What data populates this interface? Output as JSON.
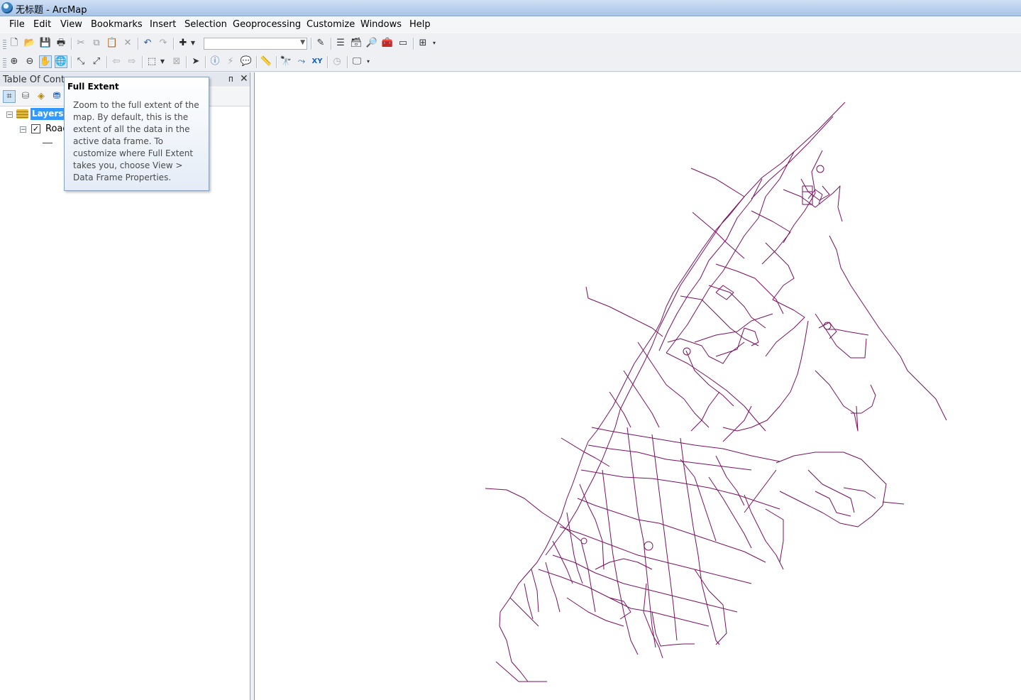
{
  "window": {
    "title": "无标题 - ArcMap"
  },
  "menu": [
    "File",
    "Edit",
    "View",
    "Bookmarks",
    "Insert",
    "Selection",
    "Geoprocessing",
    "Customize",
    "Windows",
    "Help"
  ],
  "standard_toolbar": {
    "tools": [
      "new-document-icon",
      "open-icon",
      "save-icon",
      "print-icon",
      "cut-icon",
      "copy-icon",
      "paste-icon",
      "delete-icon",
      "undo-icon",
      "redo-icon",
      "add-data-icon"
    ],
    "scale_value": "",
    "extra_tools": [
      "editor-icon",
      "table-of-contents-icon",
      "catalog-icon",
      "search-window-icon",
      "arctoolbox-icon",
      "python-icon",
      "model-builder-icon"
    ]
  },
  "tools_toolbar": {
    "tools": [
      "zoom-in-icon",
      "zoom-out-icon",
      "pan-icon",
      "full-extent-icon",
      "fixed-zoom-in-icon",
      "fixed-zoom-out-icon",
      "back-icon",
      "forward-icon",
      "select-by-graphics-icon",
      "clear-selection-icon",
      "select-elements-icon",
      "identify-icon",
      "hyperlink-icon",
      "html-popup-icon",
      "measure-icon",
      "find-icon",
      "find-route-icon",
      "go-to-xy-icon",
      "time-slider-icon",
      "viewer-icon"
    ],
    "active_tool": "full-extent-icon"
  },
  "toc": {
    "title": "Table Of Conte",
    "pin_glyph": "ᴨ",
    "close_glyph": "✕",
    "data_frame": "Layers",
    "layer": {
      "name": "Road",
      "checked": true,
      "symbol_color": "#a0164a"
    }
  },
  "tooltip": {
    "title": "Full Extent",
    "body": "Zoom to the full extent of the map. By default, this is the extent of all the data in the active data frame. To customize where Full Extent takes you, choose View > Data Frame Properties."
  },
  "map": {
    "line_color": "#7b1060",
    "background": "#ffffff"
  }
}
